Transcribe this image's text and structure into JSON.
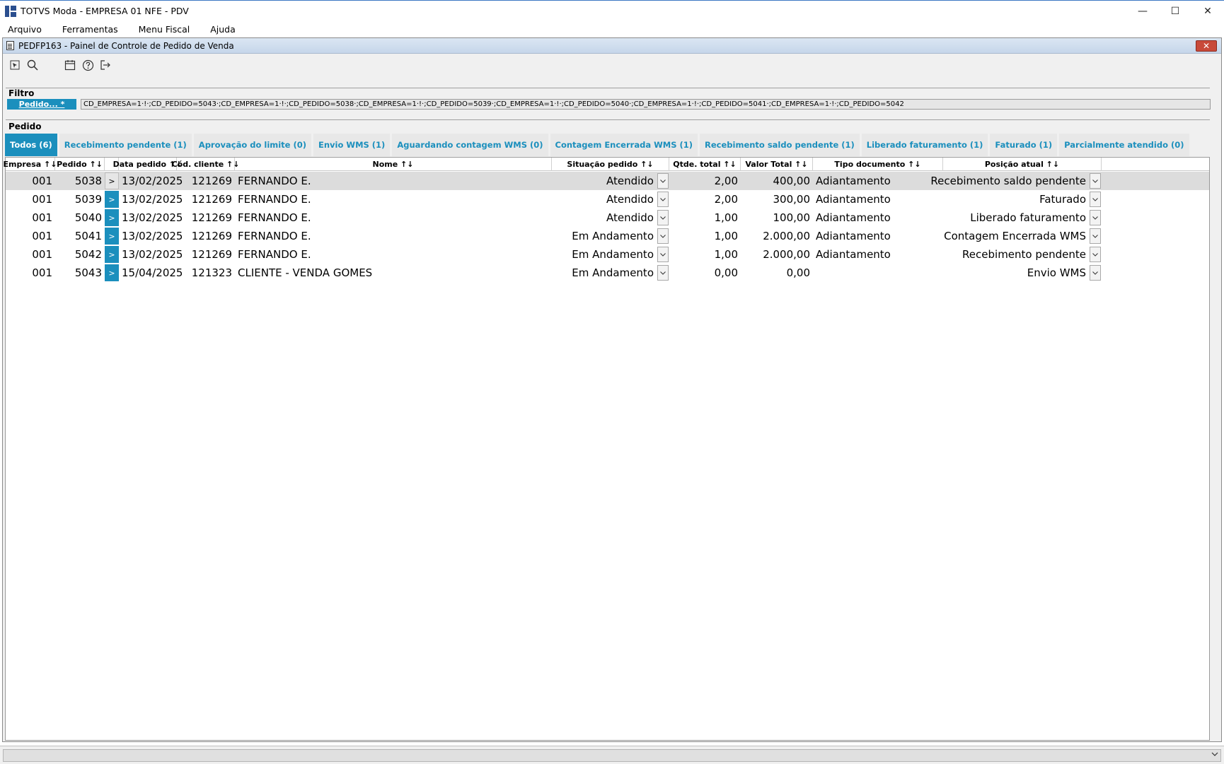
{
  "window": {
    "title": "TOTVS Moda - EMPRESA 01 NFE - PDV",
    "minimize": "—",
    "maximize": "☐",
    "close": "✕"
  },
  "menu": [
    {
      "label": "Arquivo"
    },
    {
      "label": "Ferramentas"
    },
    {
      "label": "Menu Fiscal"
    },
    {
      "label": "Ajuda"
    }
  ],
  "inner": {
    "title": "PEDFP163 - Painel de Controle de Pedido de Venda",
    "close": "✕"
  },
  "toolbar": {
    "icons": [
      "pointer-icon",
      "search-icon",
      "calendar-icon",
      "help-icon",
      "exit-icon"
    ]
  },
  "filter": {
    "section": "Filtro",
    "button": "Pedido... *",
    "value": "CD_EMPRESA=1·!·;CD_PEDIDO=5043·;CD_EMPRESA=1·!·;CD_PEDIDO=5038·;CD_EMPRESA=1·!·;CD_PEDIDO=5039·;CD_EMPRESA=1·!·;CD_PEDIDO=5040·;CD_EMPRESA=1·!·;CD_PEDIDO=5041·;CD_EMPRESA=1·!·;CD_PEDIDO=5042"
  },
  "pedido": {
    "section": "Pedido",
    "tabs": [
      {
        "label": "Todos (6)"
      },
      {
        "label": "Recebimento pendente (1)"
      },
      {
        "label": "Aprovação do limite (0)"
      },
      {
        "label": "Envio WMS (1)"
      },
      {
        "label": "Aguardando contagem WMS (0)"
      },
      {
        "label": "Contagem Encerrada WMS (1)"
      },
      {
        "label": "Recebimento saldo pendente (1)"
      },
      {
        "label": "Liberado faturamento (1)"
      },
      {
        "label": "Faturado (1)"
      },
      {
        "label": "Parcialmente atendido (0)"
      }
    ]
  },
  "grid": {
    "headers": {
      "empresa": "Empresa ↑↓",
      "pedido": "Pedido ↑↓",
      "data": "Data pedido ↑↓",
      "cliente": "Cód. cliente ↑↓",
      "nome": "Nome ↑↓",
      "situacao": "Situação pedido ↑↓",
      "qtde": "Qtde. total ↑↓",
      "valor": "Valor Total ↑↓",
      "tipo": "Tipo documento ↑↓",
      "posicao": "Posição atual ↑↓"
    },
    "rows": [
      {
        "empresa": "001",
        "pedido": "5038",
        "btn": ">",
        "data": "13/02/2025",
        "cliente": "121269",
        "nome": "FERNANDO E.",
        "situacao": "Atendido",
        "qtde": "2,00",
        "valor": "400,00",
        "tipo": "Adiantamento",
        "posicao": "Recebimento saldo pendente"
      },
      {
        "empresa": "001",
        "pedido": "5039",
        "btn": ">",
        "data": "13/02/2025",
        "cliente": "121269",
        "nome": "FERNANDO E.",
        "situacao": "Atendido",
        "qtde": "2,00",
        "valor": "300,00",
        "tipo": "Adiantamento",
        "posicao": "Faturado"
      },
      {
        "empresa": "001",
        "pedido": "5040",
        "btn": ">",
        "data": "13/02/2025",
        "cliente": "121269",
        "nome": "FERNANDO E.",
        "situacao": "Atendido",
        "qtde": "1,00",
        "valor": "100,00",
        "tipo": "Adiantamento",
        "posicao": "Liberado faturamento"
      },
      {
        "empresa": "001",
        "pedido": "5041",
        "btn": ">",
        "data": "13/02/2025",
        "cliente": "121269",
        "nome": "FERNANDO E.",
        "situacao": "Em Andamento",
        "qtde": "1,00",
        "valor": "2.000,00",
        "tipo": "Adiantamento",
        "posicao": "Contagem Encerrada WMS"
      },
      {
        "empresa": "001",
        "pedido": "5042",
        "btn": ">",
        "data": "13/02/2025",
        "cliente": "121269",
        "nome": "FERNANDO E.",
        "situacao": "Em Andamento",
        "qtde": "1,00",
        "valor": "2.000,00",
        "tipo": "Adiantamento",
        "posicao": "Recebimento pendente"
      },
      {
        "empresa": "001",
        "pedido": "5043",
        "btn": ">",
        "data": "15/04/2025",
        "cliente": "121323",
        "nome": "CLIENTE - VENDA GOMES",
        "situacao": "Em Andamento",
        "qtde": "0,00",
        "valor": "0,00",
        "tipo": "",
        "posicao": "Envio WMS"
      }
    ]
  },
  "colors": {
    "accent": "#1b8fbd",
    "selected_row": "#dcdcdc"
  }
}
